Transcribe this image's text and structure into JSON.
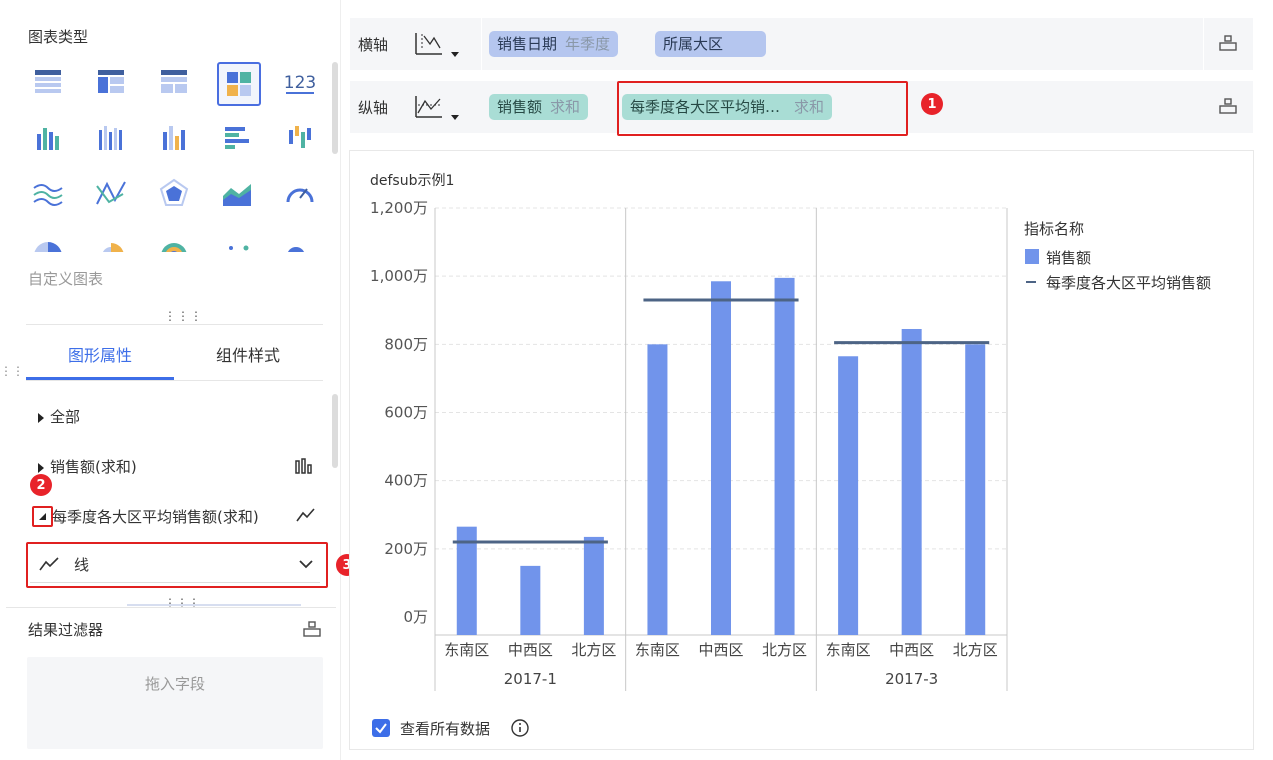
{
  "left_panel": {
    "chart_type_title": "图表类型",
    "custom_chart_label": "自定义图表",
    "tabs": [
      "图形属性",
      "组件样式"
    ],
    "properties": {
      "all": "全部",
      "sales_sum": "销售额(求和)",
      "avg_sales_sum": "每季度各大区平均销售额(求和)",
      "shape_select": "线"
    },
    "result_filter": {
      "title": "结果过滤器",
      "drop_placeholder": "拖入字段"
    },
    "badges": [
      "2",
      "3"
    ]
  },
  "axes": {
    "x_label": "横轴",
    "y_label": "纵轴",
    "x_fields": [
      {
        "name": "销售日期",
        "agg": "年季度"
      },
      {
        "name": "所属大区",
        "agg": ""
      }
    ],
    "y_fields": [
      {
        "name": "销售额",
        "agg": "求和"
      },
      {
        "name": "每季度各大区平均销…",
        "agg": "求和"
      }
    ],
    "badge": "1"
  },
  "view_all_data": "查看所有数据",
  "chart_data": {
    "type": "bar",
    "title": "defsub示例1",
    "legend_title": "指标名称",
    "legend_position": "right",
    "groups": [
      "2017-1",
      "",
      "2017-3"
    ],
    "categories": [
      "东南区",
      "中西区",
      "北方区",
      "东南区",
      "中西区",
      "北方区",
      "东南区",
      "中西区",
      "北方区"
    ],
    "y_tick_labels": [
      "0万",
      "200万",
      "400万",
      "600万",
      "800万",
      "1,000万",
      "1,200万"
    ],
    "ylim": [
      0,
      1200
    ],
    "grid": true,
    "series": [
      {
        "name": "销售额",
        "type": "bar",
        "color": "#7194eb",
        "values": [
          265,
          150,
          235,
          800,
          985,
          995,
          765,
          845,
          800
        ]
      },
      {
        "name": "每季度各大区平均销售额",
        "type": "line",
        "color": "#4d6485",
        "group_values": [
          220,
          930,
          805
        ]
      }
    ]
  }
}
